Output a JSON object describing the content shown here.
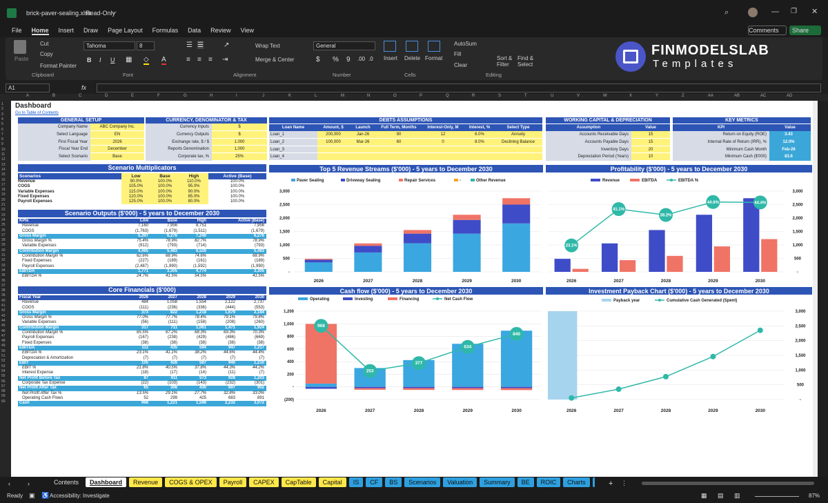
{
  "window": {
    "title": "brick-paver-sealing.xlsx",
    "mode": "Read-Only"
  },
  "menu": [
    "File",
    "Home",
    "Insert",
    "Draw",
    "Page Layout",
    "Formulas",
    "Data",
    "Review",
    "View"
  ],
  "menu_right": {
    "comments": "Comments",
    "share": "Share"
  },
  "ribbon": {
    "paste": "Paste",
    "cut": "Cut",
    "copy": "Copy",
    "format_painter": "Format Painter",
    "clipboard": "Clipboard",
    "font_name": "Tahoma",
    "font_size": "8",
    "font": "Font",
    "wrap": "Wrap Text",
    "merge": "Merge & Center",
    "alignment": "Alignment",
    "numfmt": "General",
    "number": "Number",
    "insert": "Insert",
    "delete": "Delete",
    "format": "Format",
    "cells": "Cells",
    "autosum": "AutoSum",
    "fill": "Fill",
    "clear": "Clear",
    "sort": "Sort & Filter",
    "find": "Find & Select",
    "editing": "Editing",
    "brand1": "FINMODELSLAB",
    "brand2": "Templates"
  },
  "namebox": "A1",
  "columns": [
    "A",
    "B",
    "C",
    "D",
    "E",
    "F",
    "G",
    "H",
    "I",
    "J",
    "K",
    "L",
    "M",
    "N",
    "O",
    "P",
    "Q",
    "R",
    "S",
    "T",
    "U",
    "V",
    "W",
    "X",
    "Y",
    "Z",
    "AA",
    "AB",
    "AC",
    "AD"
  ],
  "sheet": {
    "title": "Dashboard",
    "link": "Go to Table of Contents",
    "general": {
      "title": "GENERAL SETUP",
      "rows": [
        [
          "Company Name",
          "ABC Company Inc."
        ],
        [
          "Select Language",
          "EN"
        ],
        [
          "First Fiscal Year",
          "2026"
        ],
        [
          "Fiscal Year End",
          "December"
        ],
        [
          "Select Scenario",
          "Base"
        ]
      ]
    },
    "currency": {
      "title": "CURRENCY, DENOMINATOR & TAX",
      "rows": [
        [
          "Currency Inputs",
          "$"
        ],
        [
          "Currency Outputs",
          "$"
        ],
        [
          "Exchange rate, $ / $",
          "1.000"
        ],
        [
          "Reports Denomination",
          "1,000"
        ],
        [
          "Corporate tax, %",
          "25%"
        ]
      ]
    },
    "debts": {
      "title": "DEBTS ASSUMPTIONS",
      "headers": [
        "Loan Name",
        "Amount, $",
        "Launch",
        "Full Term, Months",
        "Interest-Only, M",
        "Interest, %",
        "Select Type"
      ],
      "rows": [
        [
          "Loan_1",
          "200,000",
          "Jan-26",
          "90",
          "12",
          "6.0%",
          "Annuity"
        ],
        [
          "Loan_2",
          "100,000",
          "Mar-26",
          "60",
          "0",
          "8.0%",
          "Declining Balance"
        ],
        [
          "Loan_3",
          "",
          "",
          "",
          "",
          "",
          ""
        ],
        [
          "Loan_4",
          "",
          "",
          "",
          "",
          "",
          ""
        ]
      ]
    },
    "wc": {
      "title": "WORKING CAPITAL & DEPRECIATION",
      "headers": [
        "Assumption",
        "Value"
      ],
      "rows": [
        [
          "Accounts Receivable Days",
          "15"
        ],
        [
          "Accounts Payable Days",
          "15"
        ],
        [
          "Inventory Days",
          "20"
        ],
        [
          "Depreciation Period (Years)",
          "10"
        ]
      ]
    },
    "kpi": {
      "title": "KEY METRICS",
      "headers": [
        "KPI",
        "Value"
      ],
      "rows": [
        [
          "Return on Equity (ROE)",
          "3.43"
        ],
        [
          "Internal Rate of Return (IRR), %",
          "12.0%"
        ],
        [
          "Minimum Cash Month",
          "Feb-26"
        ],
        [
          "Minimum Cash ($'000)",
          "83.6"
        ]
      ]
    },
    "mult": {
      "title": "Scenario Multiplicators",
      "headers": [
        "Scenarios",
        "Low",
        "Base",
        "High",
        "Active (Base)"
      ],
      "rows": [
        [
          "Revenue",
          "90.0%",
          "100.0%",
          "110.0%",
          "100.0%"
        ],
        [
          "COGS",
          "105.0%",
          "100.0%",
          "95.0%",
          "100.0%"
        ],
        [
          "Variable Expenses",
          "115.0%",
          "100.0%",
          "90.0%",
          "100.0%"
        ],
        [
          "Fixed Expenses",
          "120.0%",
          "100.0%",
          "85.0%",
          "100.0%"
        ],
        [
          "Payroll Expenses",
          "125.0%",
          "100.0%",
          "80.0%",
          "100.0%"
        ]
      ]
    },
    "outputs": {
      "title": "Scenario Outputs ($'000) - 5 years to December 2030",
      "headers": [
        "KPIs",
        "Low",
        "Base",
        "High",
        "Active (Base)"
      ],
      "rows": [
        [
          "Revenue",
          "7,160",
          "7,956",
          "8,751",
          "7,956",
          "n"
        ],
        [
          "COGS",
          "(1,763)",
          "(1,679)",
          "(1,511)",
          "(1,679)",
          "n"
        ],
        [
          "Gross Margin",
          "5,397",
          "6,276",
          "7,240",
          "6,276",
          "h"
        ],
        [
          "Gross Margin %",
          "75.4%",
          "78.9%",
          "82.7%",
          "78.9%",
          "i"
        ],
        [
          "Variable Expenses",
          "(912)",
          "(793)",
          "(714)",
          "(793)",
          "n"
        ],
        [
          "Contribution Margin",
          "4,485",
          "5,483",
          "6,526",
          "5,483",
          "h"
        ],
        [
          "Contribution Margin %",
          "62.6%",
          "68.9%",
          "74.6%",
          "68.9%",
          "i"
        ],
        [
          "Fixed Expenses",
          "(227)",
          "(189)",
          "(161)",
          "(189)",
          "n"
        ],
        [
          "Payroll Expenses",
          "(2,487)",
          "(1,990)",
          "(1,592)",
          "(1,990)",
          "n"
        ],
        [
          "EBITDA",
          "1,771",
          "3,305",
          "4,774",
          "3,305",
          "h"
        ],
        [
          "EBITDA %",
          "24.7%",
          "41.5%",
          "54.5%",
          "41.5%",
          "i"
        ]
      ]
    },
    "core": {
      "title": "Core Financials ($'000)",
      "headers": [
        "Fiscal Year",
        "2026",
        "2027",
        "2028",
        "2029",
        "2030"
      ],
      "rows": [
        [
          "Revenue",
          "484",
          "1,058",
          "1,554",
          "2,122",
          "2,737",
          "n"
        ],
        [
          "COGS",
          "(111)",
          "(236)",
          "(336)",
          "(444)",
          "(553)",
          "n"
        ],
        [
          "Gross Margin",
          "373",
          "822",
          "1,218",
          "1,679",
          "2,184",
          "h"
        ],
        [
          "Gross Margin %",
          "77.0%",
          "77.7%",
          "78.4%",
          "79.1%",
          "79.8%",
          "i"
        ],
        [
          "Variable Expenses",
          "(56)",
          "(111)",
          "(158)",
          "(208)",
          "(260)",
          "n"
        ],
        [
          "Contribution Margin",
          "317",
          "711",
          "1,061",
          "1,471",
          "1,924",
          "h"
        ],
        [
          "Contribution Margin %",
          "65.5%",
          "67.2%",
          "68.3%",
          "69.3%",
          "70.3%",
          "i"
        ],
        [
          "Payroll Expenses",
          "(167)",
          "(238)",
          "(429)",
          "(486)",
          "(669)",
          "n"
        ],
        [
          "Fixed Expenses",
          "(38)",
          "(38)",
          "(38)",
          "(38)",
          "(38)",
          "n"
        ],
        [
          "EBITDA",
          "112",
          "435",
          "594",
          "947",
          "1,217",
          "h"
        ],
        [
          "EBITDA %",
          "23.1%",
          "41.1%",
          "38.2%",
          "44.6%",
          "44.4%",
          "i"
        ],
        [
          "Depreciation & Amortization",
          "(7)",
          "(7)",
          "(7)",
          "(7)",
          "(7)",
          "n"
        ],
        [
          "EBIT",
          "105",
          "428",
          "587",
          "940",
          "1,210",
          "h"
        ],
        [
          "EBIT %",
          "21.8%",
          "40.5%",
          "37.8%",
          "44.3%",
          "44.2%",
          "i"
        ],
        [
          "Interest Expense",
          "(18)",
          "(17)",
          "(14)",
          "(11)",
          "(7)",
          "n"
        ],
        [
          "Net Profit Before Tax",
          "87",
          "411",
          "573",
          "928",
          "1,203",
          "h"
        ],
        [
          "Corporate Tax Expense",
          "(22)",
          "(103)",
          "(143)",
          "(232)",
          "(301)",
          "n"
        ],
        [
          "Net Profit After Tax",
          "65",
          "308",
          "430",
          "697",
          "902",
          "h"
        ],
        [
          "Net Profit After Tax %",
          "13.5%",
          "29.1%",
          "27.7%",
          "32.8%",
          "33.0%",
          "i"
        ],
        [
          "Operating Cash Flows",
          "52",
          "299",
          "425",
          "683",
          "891",
          "n"
        ],
        [
          "Cash",
          "968",
          "1,221",
          "1,598",
          "2,232",
          "3,072",
          "h"
        ]
      ]
    }
  },
  "charts": {
    "revenue": {
      "title": "Top 5 Revenue Streams ($'000) - 5 years to December 2030",
      "legend": [
        "Paver Sealing",
        "Driveway Sealing",
        "Repair Services",
        "-",
        "Other Revenue"
      ],
      "colors": [
        "#3ba7e0",
        "#3f4cc8",
        "#f07466",
        "#f5a623",
        "#2fb8a8"
      ]
    },
    "profit": {
      "title": "Profitability ($'000) - 5 years to December 2030",
      "legend": [
        "Revenue",
        "EBITDA",
        "EBITDA %"
      ]
    },
    "cash": {
      "title": "Cash flow ($'000) - 5 years to December 2030",
      "legend": [
        "Operating",
        "Investing",
        "Financing",
        "Net Cash Flow"
      ]
    },
    "payback": {
      "title": "Investment Payback Chart ($'000) - 5 years to December 2030",
      "legend": [
        "Payback year",
        "Cumulative Cash Generated (Spent)"
      ]
    }
  },
  "chart_data": [
    {
      "type": "bar",
      "title": "Top 5 Revenue Streams ($'000) - 5 years to December 2030",
      "categories": [
        "2026",
        "2027",
        "2028",
        "2029",
        "2030"
      ],
      "ylim": [
        0,
        3000
      ],
      "series": [
        {
          "name": "Paver Sealing",
          "values": [
            350,
            720,
            1060,
            1420,
            1800
          ]
        },
        {
          "name": "Driveway Sealing",
          "values": [
            100,
            250,
            360,
            510,
            700
          ]
        },
        {
          "name": "Repair Services",
          "values": [
            34,
            88,
            134,
            192,
            237
          ]
        }
      ]
    },
    {
      "type": "bar",
      "title": "Profitability ($'000) - 5 years to December 2030",
      "categories": [
        "2026",
        "2027",
        "2028",
        "2029",
        "2030"
      ],
      "ylim": [
        0,
        3000
      ],
      "series": [
        {
          "name": "Revenue",
          "values": [
            484,
            1058,
            1554,
            2122,
            2737
          ]
        },
        {
          "name": "EBITDA",
          "values": [
            112,
            435,
            594,
            947,
            1217
          ]
        },
        {
          "name": "EBITDA %",
          "values": [
            23.1,
            41.1,
            38.2,
            44.6,
            44.4
          ]
        }
      ]
    },
    {
      "type": "bar",
      "title": "Cash flow ($'000) - 5 years to December 2030",
      "categories": [
        "2026",
        "2027",
        "2028",
        "2029",
        "2030"
      ],
      "ylim": [
        -200,
        1200
      ],
      "series": [
        {
          "name": "Operating",
          "values": [
            52,
            299,
            425,
            683,
            891
          ]
        },
        {
          "name": "Investing",
          "values": [
            -30,
            -20,
            -20,
            -20,
            -20
          ]
        },
        {
          "name": "Financing",
          "values": [
            946,
            -26,
            -28,
            -29,
            -31
          ]
        },
        {
          "name": "Net Cash Flow",
          "values": [
            968,
            253,
            377,
            634,
            840
          ]
        }
      ]
    },
    {
      "type": "line",
      "title": "Investment Payback Chart ($'000) - 5 years to December 2030",
      "categories": [
        "2026",
        "2027",
        "2028",
        "2029",
        "2030"
      ],
      "ylim": [
        0,
        3000
      ],
      "series": [
        {
          "name": "Cumulative Cash Generated (Spent)",
          "values": [
            52,
            351,
            776,
            1459,
            2350
          ]
        }
      ]
    }
  ],
  "sheet_tabs": [
    {
      "label": "Contents",
      "bg": "#1b1b1b",
      "fg": "#ddd"
    },
    {
      "label": "Dashboard",
      "bg": "#ffffff",
      "fg": "#111"
    },
    {
      "label": "Revenue",
      "bg": "#ffe84a",
      "fg": "#111"
    },
    {
      "label": "COGS & OPEX",
      "bg": "#ffe84a",
      "fg": "#111"
    },
    {
      "label": "Payroll",
      "bg": "#ffe84a",
      "fg": "#111"
    },
    {
      "label": "CAPEX",
      "bg": "#ffe84a",
      "fg": "#111"
    },
    {
      "label": "CapTable",
      "bg": "#ffe84a",
      "fg": "#111"
    },
    {
      "label": "Capital",
      "bg": "#ffe84a",
      "fg": "#111"
    },
    {
      "label": "IS",
      "bg": "#2ea0e0",
      "fg": "#111"
    },
    {
      "label": "CF",
      "bg": "#2ea0e0",
      "fg": "#111"
    },
    {
      "label": "BS",
      "bg": "#2ea0e0",
      "fg": "#111"
    },
    {
      "label": "Scenarios",
      "bg": "#2ea0e0",
      "fg": "#111"
    },
    {
      "label": "Valuation",
      "bg": "#2ea0e0",
      "fg": "#111"
    },
    {
      "label": "Summary",
      "bg": "#2ea0e0",
      "fg": "#111"
    },
    {
      "label": "BE",
      "bg": "#2ea0e0",
      "fg": "#111"
    },
    {
      "label": "ROIC",
      "bg": "#2ea0e0",
      "fg": "#111"
    },
    {
      "label": "Charts",
      "bg": "#2ea0e0",
      "fg": "#111"
    },
    {
      "label": "KPIs",
      "bg": "#2ea0e0",
      "fg": "#111"
    }
  ],
  "status": {
    "ready": "Ready",
    "access": "Accessibility: Investigate",
    "zoom": "87%"
  }
}
